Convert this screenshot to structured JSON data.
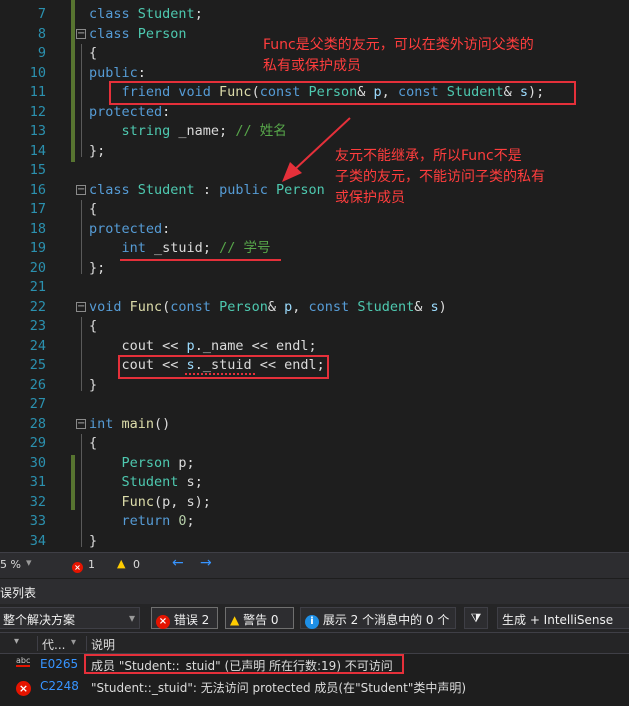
{
  "editor": {
    "line_numbers": [
      "7",
      "8",
      "9",
      "10",
      "11",
      "12",
      "13",
      "14",
      "15",
      "16",
      "17",
      "18",
      "19",
      "20",
      "21",
      "22",
      "23",
      "24",
      "25",
      "26",
      "27",
      "28",
      "29",
      "30",
      "31",
      "32",
      "33",
      "34"
    ],
    "annotations": {
      "note1": [
        "Func是父类的友元，可以在类外访问父类的",
        "私有或保护成员"
      ],
      "note2": [
        "友元不能继承，所以Func不是",
        "子类的友元，不能访问子类的私有",
        "或保护成员"
      ]
    }
  },
  "statusbar": {
    "zoom": "5 %",
    "error_count": "1",
    "warning_count": "0"
  },
  "error_list": {
    "title": "误列表",
    "scope": "整个解决方案",
    "errors_button": "错误 2",
    "warnings_button": "警告 0",
    "messages_button": "展示 2 个消息中的 0 个",
    "build_filter": "生成 + IntelliSense",
    "columns": {
      "code": "代...",
      "description": "说明"
    },
    "rows": [
      {
        "code": "E0265",
        "description": "成员 \"Student::_stuid\" (已声明 所在行数:19) 不可访问"
      },
      {
        "code": "C2248",
        "description": "\"Student::_stuid\": 无法访问 protected 成员(在\"Student\"类中声明)"
      }
    ]
  },
  "colors": {
    "accent": "#e5303a",
    "keyword": "#569cd6",
    "type": "#4ec9b0",
    "comment": "#57a64a"
  }
}
